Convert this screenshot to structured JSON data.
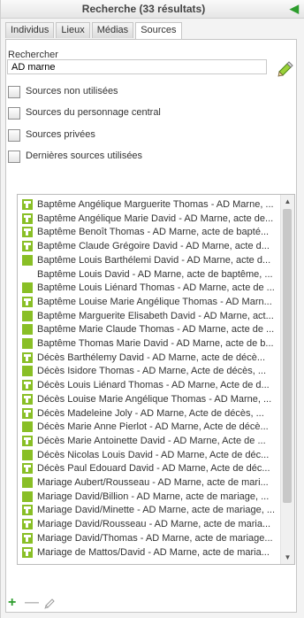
{
  "title": "Recherche (33 résultats)",
  "tabs": [
    "Individus",
    "Lieux",
    "Médias",
    "Sources"
  ],
  "search": {
    "label": "Rechercher",
    "value": "AD marne"
  },
  "filters": [
    {
      "label": "Sources non utilisées",
      "checked": false
    },
    {
      "label": "Sources du personnage central",
      "checked": false
    },
    {
      "label": "Sources privées",
      "checked": false
    },
    {
      "label": "Dernières sources utilisées",
      "checked": false
    }
  ],
  "sources": [
    {
      "label": "Baptême Angélique Marguerite Thomas - AD Marne, ...",
      "icon": "green-t-icon"
    },
    {
      "label": "Baptême Angélique Marie David - AD Marne, acte de...",
      "icon": "green-t-icon"
    },
    {
      "label": "Baptême Benoît Thomas - AD Marne, acte de bapté...",
      "icon": "green-t-icon"
    },
    {
      "label": "Baptême Claude Grégoire David - AD Marne, acte d...",
      "icon": "green-t-icon"
    },
    {
      "label": "Baptême Louis Barthélemi David - AD Marne, acte d...",
      "icon": "green-square-icon"
    },
    {
      "label": "Baptême Louis David - AD Marne, acte de baptême, ...",
      "icon": ""
    },
    {
      "label": "Baptême Louis Liénard Thomas - AD Marne, acte de ...",
      "icon": "green-square-icon"
    },
    {
      "label": "Baptême Louise Marie Angélique Thomas - AD Marn...",
      "icon": "green-t-icon"
    },
    {
      "label": "Baptême Marguerite Elisabeth David - AD Marne, act...",
      "icon": "green-square-icon"
    },
    {
      "label": "Baptême Marie Claude Thomas - AD Marne, acte de ...",
      "icon": "green-square-icon"
    },
    {
      "label": "Baptême Thomas Marie David - AD Marne, acte de b...",
      "icon": "green-square-icon"
    },
    {
      "label": "Décès Barthélemy David - AD Marne, acte de décè...",
      "icon": "green-t-icon"
    },
    {
      "label": "Décès Isidore Thomas - AD Marne, Acte de décès, ...",
      "icon": "green-square-icon"
    },
    {
      "label": "Décès Louis Liénard Thomas - AD Marne, Acte de d...",
      "icon": "green-t-icon"
    },
    {
      "label": "Décès Louise Marie Angélique Thomas - AD Marne, ...",
      "icon": "green-t-icon"
    },
    {
      "label": "Décès Madeleine Joly - AD Marne, Acte de décès, ...",
      "icon": "green-t-icon"
    },
    {
      "label": "Décès Marie Anne Pierlot - AD Marne, Acte de décè...",
      "icon": "green-square-icon"
    },
    {
      "label": "Décès Marie Antoinette David - AD Marne, Acte de ...",
      "icon": "green-t-icon"
    },
    {
      "label": "Décès Nicolas Louis David - AD Marne, Acte de déc...",
      "icon": "green-square-icon"
    },
    {
      "label": "Décès Paul Edouard David - AD Marne, Acte de déc...",
      "icon": "green-t-icon"
    },
    {
      "label": "Mariage Aubert/Rousseau - AD Marne, acte de mari...",
      "icon": "green-square-icon"
    },
    {
      "label": "Mariage David/Billion - AD Marne, acte de mariage, ...",
      "icon": "green-square-icon"
    },
    {
      "label": "Mariage David/Minette - AD Marne, acte de mariage, ...",
      "icon": "green-t-icon"
    },
    {
      "label": "Mariage David/Rousseau - AD Marne, acte de maria...",
      "icon": "green-t-icon"
    },
    {
      "label": "Mariage David/Thomas - AD Marne, acte de mariage...",
      "icon": "green-t-icon"
    },
    {
      "label": "Mariage de Mattos/David - AD Marne, acte de maria...",
      "icon": "green-t-icon"
    }
  ],
  "colors": {
    "accent": "#2d9d2d",
    "icon": "#89bf26"
  },
  "icons": {
    "collapse": "chevron-left-icon",
    "add": "plus-icon",
    "remove": "minus-icon",
    "edit": "pencil-icon"
  }
}
